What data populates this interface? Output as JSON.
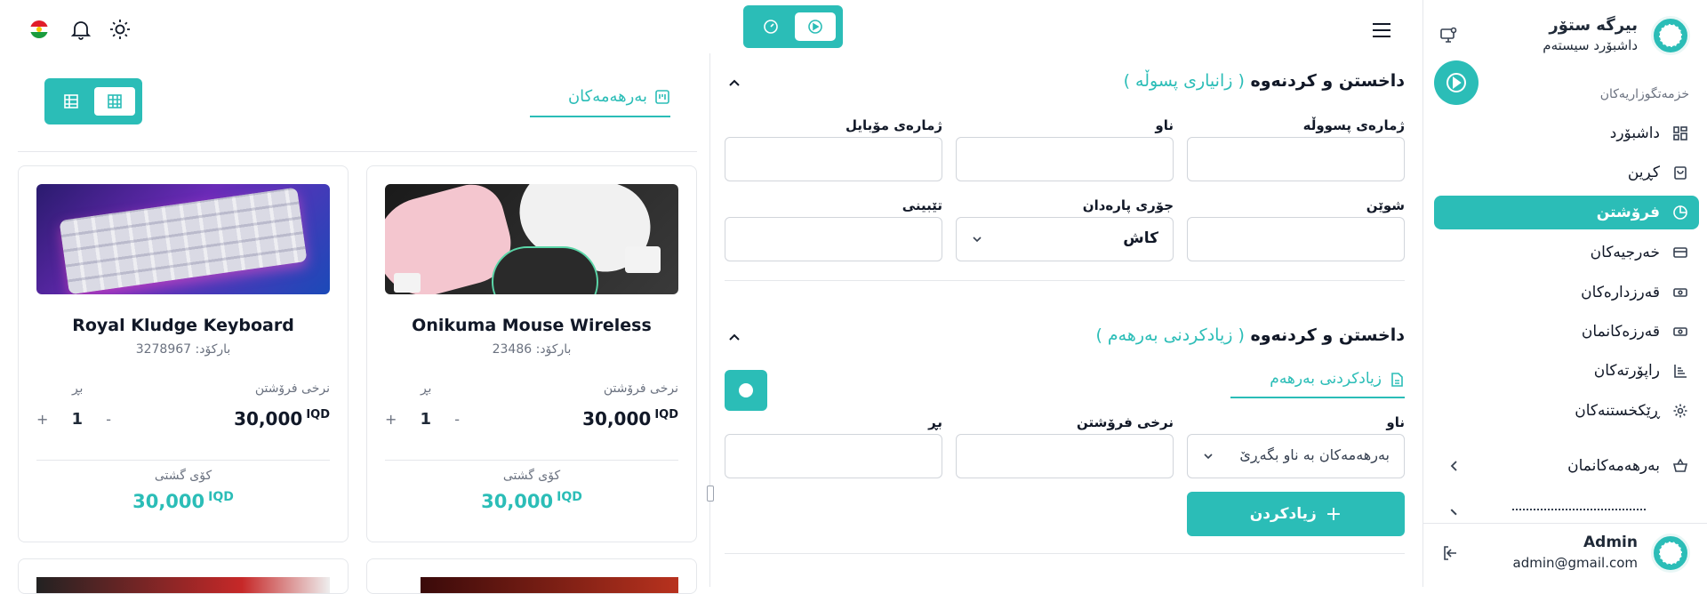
{
  "brand": {
    "title": "بیرگە ستۆر",
    "subtitle": "داشبۆرد سیستەم"
  },
  "sidebar": {
    "section_label": "خزمەتگوزاریەکان",
    "items": [
      {
        "label": "داشبۆرد",
        "icon": "grid-icon"
      },
      {
        "label": "کڕین",
        "icon": "shopping-bag-icon"
      },
      {
        "label": "فرۆشتن",
        "icon": "pie-chart-icon",
        "active": true
      },
      {
        "label": "خەرجیەکان",
        "icon": "card-icon"
      },
      {
        "label": "قەرزدارەکان",
        "icon": "money-icon"
      },
      {
        "label": "قەرزەکانمان",
        "icon": "money-icon"
      },
      {
        "label": "راپۆرتەکان",
        "icon": "chart-icon"
      },
      {
        "label": "ڕێکخستنەکان",
        "icon": "gear-icon"
      },
      {
        "label": "بەرهەمەکانمان",
        "icon": "basket-icon"
      }
    ],
    "user": {
      "name": "Admin",
      "email": "admin@gmail.com"
    }
  },
  "form": {
    "invoice_section": {
      "title": "داخستن و کردنەوە",
      "subtitle": "( زانیاری پسوڵە )"
    },
    "invoice_number_label": "ژمارەی پسووڵە",
    "name_label": "ناو",
    "mobile_label": "ژمارەی مۆبایل",
    "location_label": "شوێن",
    "payment_type_label": "جۆری پارەدان",
    "payment_type_value": "کاش",
    "note_label": "تێبینی",
    "product_section": {
      "title": "داخستن و کردنەوە",
      "subtitle": "( زیادکردنی بەرهەم )"
    },
    "add_product_tab": "زیادکردنی بەرهەم",
    "product_name_label": "ناو",
    "product_name_placeholder": "بەرهەمەکان بە ناو بگەڕێ",
    "sale_price_label": "نرخی فرۆشتن",
    "quantity_label": "بڕ",
    "add_button": "زیادکردن"
  },
  "products_panel": {
    "title": "بەرهەمەکان",
    "cards": [
      {
        "name": "Onikuma Mouse Wireless",
        "barcode": "بارکۆد: 23486",
        "price_label": "نرخی فرۆشتن",
        "qty_label": "بڕ",
        "price": "30,000",
        "currency": "IQD",
        "qty": "1",
        "total_label": "کۆی گشتی",
        "total": "30,000"
      },
      {
        "name": "Royal Kludge Keyboard",
        "barcode": "بارکۆد: 3278967",
        "price_label": "نرخی فرۆشتن",
        "qty_label": "بڕ",
        "price": "30,000",
        "currency": "IQD",
        "qty": "1",
        "total_label": "کۆی گشتی",
        "total": "30,000"
      }
    ]
  },
  "colors": {
    "accent": "#2bbdb7"
  }
}
